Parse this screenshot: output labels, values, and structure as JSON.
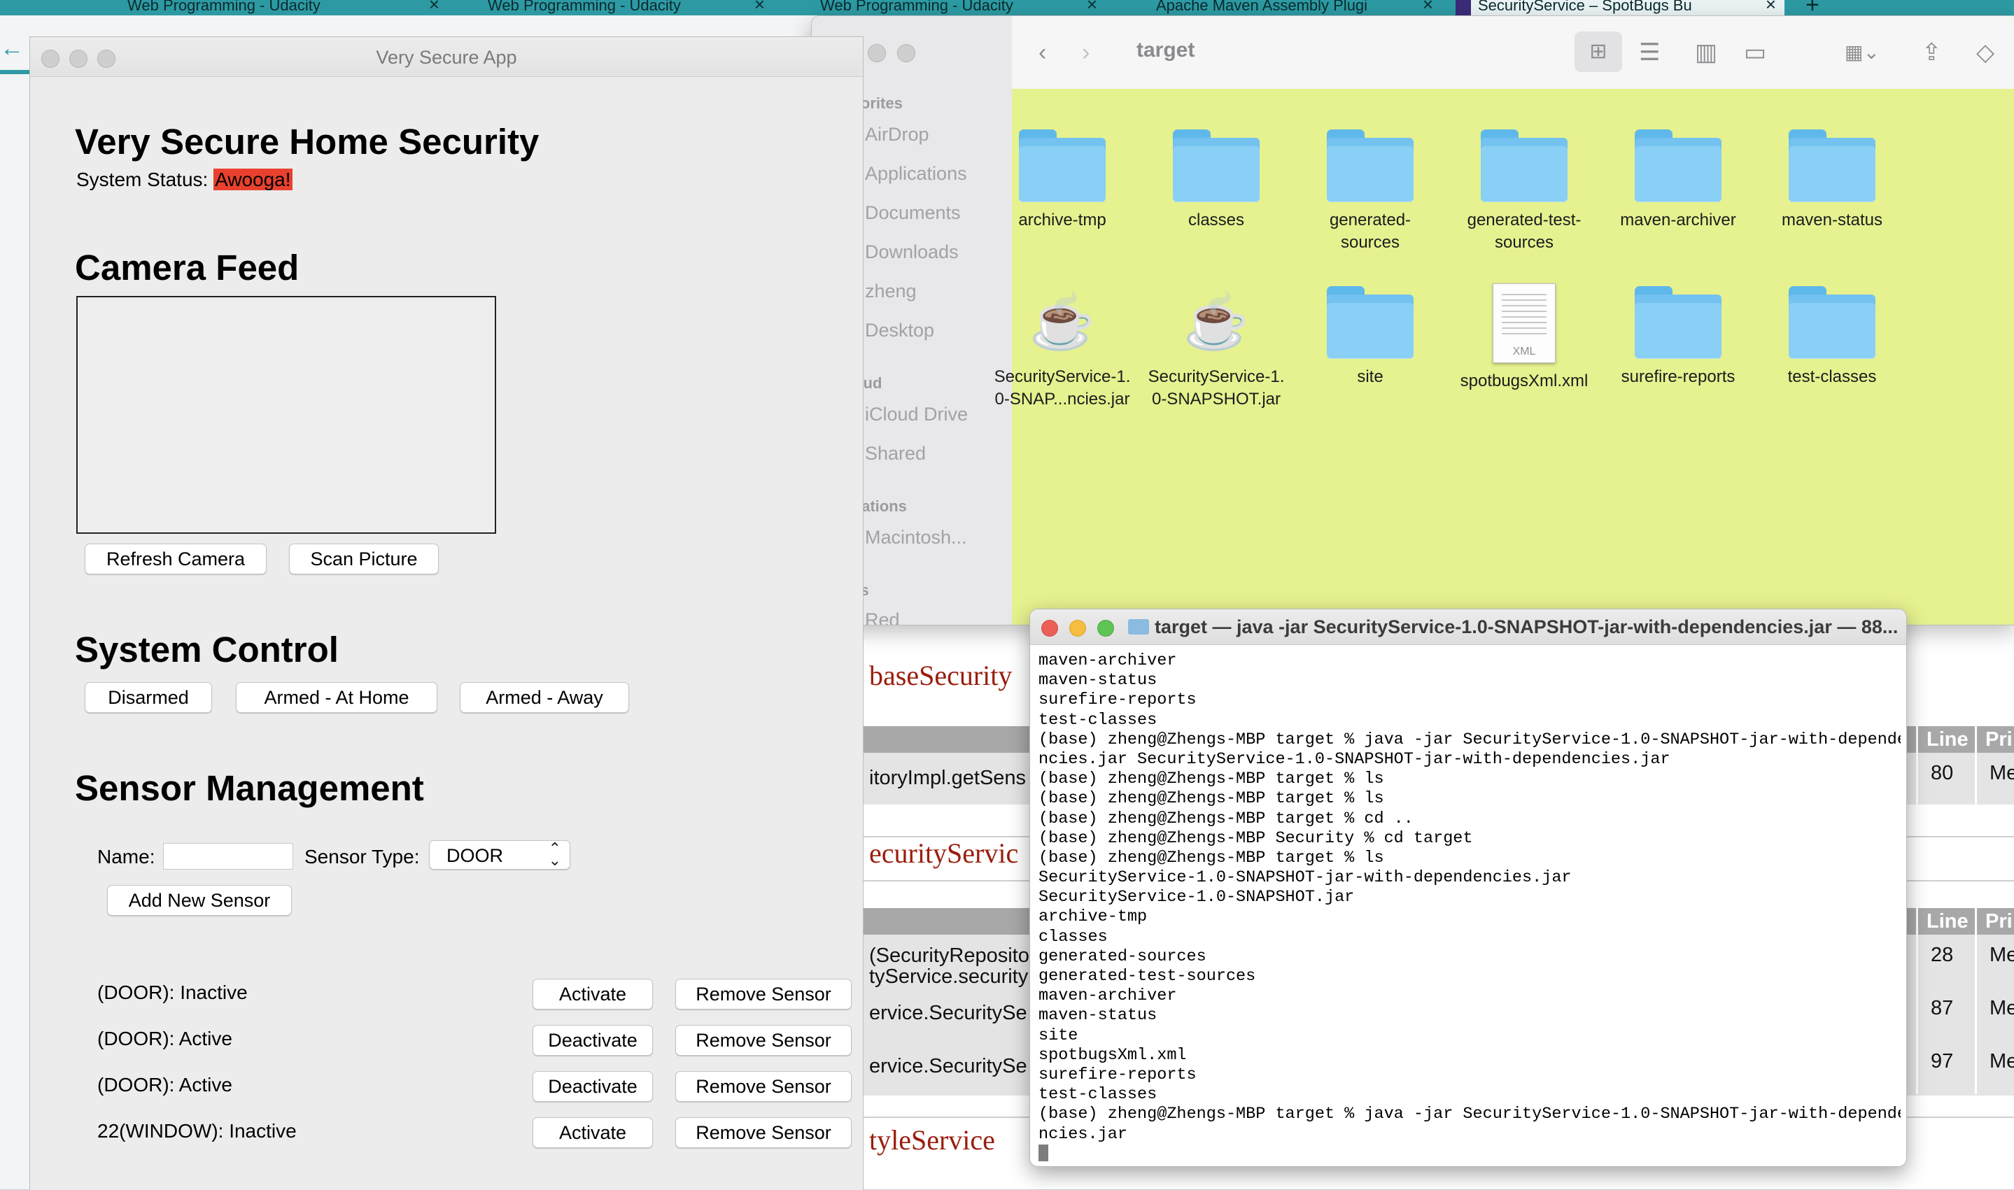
{
  "browser": {
    "tabs": [
      {
        "label": "Web Programming - Udacity",
        "active": false
      },
      {
        "label": "Web Programming - Udacity",
        "active": false
      },
      {
        "label": "Web Programming - Udacity",
        "active": false
      },
      {
        "label": "Apache Maven Assembly Plugi",
        "active": false
      },
      {
        "label": "SecurityService – SpotBugs Bu",
        "active": true
      }
    ],
    "new_tab": "+",
    "back": "←"
  },
  "report": {
    "section_1": "baseSecurity",
    "section_2": "ecurityServic",
    "section_3": "tyleService",
    "columns": {
      "line": "Line",
      "priority": "Pri"
    },
    "rows": [
      {
        "method": "itoryImpl.getSens",
        "line": "80",
        "priority": "Me"
      },
      {
        "method": "(SecurityReposito",
        "method2": "tyService.security",
        "line": "28",
        "priority": "Me"
      },
      {
        "method": "ervice.SecuritySe",
        "line": "87",
        "priority": "Me"
      },
      {
        "method": "ervice.SecuritySe",
        "line": "97",
        "priority": "Me"
      }
    ]
  },
  "app": {
    "window_title": "Very Secure App",
    "heading": "Very Secure Home Security",
    "status_label": "System Status:",
    "status_value": "Awooga!",
    "status_color": "#e9412e",
    "camera_heading": "Camera Feed",
    "refresh_camera": "Refresh Camera",
    "scan_picture": "Scan Picture",
    "system_control_heading": "System Control",
    "disarmed": "Disarmed",
    "armed_home": "Armed - At Home",
    "armed_away": "Armed - Away",
    "sensor_heading": "Sensor Management",
    "name_label": "Name:",
    "name_value": "",
    "sensor_type_label": "Sensor Type:",
    "sensor_type_value": "DOOR",
    "add_sensor": "Add New Sensor",
    "sensors": [
      {
        "label": "(DOOR): Inactive",
        "toggle": "Activate",
        "remove": "Remove Sensor"
      },
      {
        "label": "(DOOR): Active",
        "toggle": "Deactivate",
        "remove": "Remove Sensor"
      },
      {
        "label": "(DOOR): Active",
        "toggle": "Deactivate",
        "remove": "Remove Sensor"
      },
      {
        "label": "22(WINDOW): Inactive",
        "toggle": "Activate",
        "remove": "Remove Sensor"
      }
    ]
  },
  "finder": {
    "path": "target",
    "sidebar": {
      "favorites_heading": "Favorites",
      "favorites": [
        {
          "label": "AirDrop",
          "icon": "airdrop-icon"
        },
        {
          "label": "Applications",
          "icon": "applications-icon"
        },
        {
          "label": "Documents",
          "icon": "documents-icon"
        },
        {
          "label": "Downloads",
          "icon": "downloads-icon"
        },
        {
          "label": "zheng",
          "icon": "home-icon"
        },
        {
          "label": "Desktop",
          "icon": "desktop-icon"
        }
      ],
      "icloud_heading": "iCloud",
      "icloud": [
        {
          "label": "iCloud Drive",
          "icon": "cloud-icon"
        },
        {
          "label": "Shared",
          "icon": "shared-folder-icon"
        }
      ],
      "locations_heading": "Locations",
      "locations": [
        {
          "label": "Macintosh...",
          "icon": "disk-icon"
        }
      ],
      "tags_heading": "Tags",
      "tags": [
        {
          "label": "Red",
          "color": "#f4a4a4"
        }
      ]
    },
    "items": [
      {
        "name": "archive-tmp",
        "kind": "folder"
      },
      {
        "name": "classes",
        "kind": "folder"
      },
      {
        "name": "generated-\nsources",
        "kind": "folder"
      },
      {
        "name": "generated-test-\nsources",
        "kind": "folder"
      },
      {
        "name": "maven-archiver",
        "kind": "folder"
      },
      {
        "name": "maven-status",
        "kind": "folder"
      },
      {
        "name": "SecurityService-1.\n0-SNAP...ncies.jar",
        "kind": "jar"
      },
      {
        "name": "SecurityService-1.\n0-SNAPSHOT.jar",
        "kind": "jar"
      },
      {
        "name": "site",
        "kind": "folder"
      },
      {
        "name": "spotbugsXml.xml",
        "kind": "xml",
        "badge": "XML"
      },
      {
        "name": "surefire-reports",
        "kind": "folder"
      },
      {
        "name": "test-classes",
        "kind": "folder"
      }
    ],
    "content_color": "#e6f18f"
  },
  "terminal": {
    "title": "target — java -jar SecurityService-1.0-SNAPSHOT-jar-with-dependencies.jar — 88...",
    "lines": [
      "maven-archiver",
      "maven-status",
      "surefire-reports",
      "test-classes",
      "(base) zheng@Zhengs-MBP target % java -jar SecurityService-1.0-SNAPSHOT-jar-with-depende",
      "ncies.jar SecurityService-1.0-SNAPSHOT-jar-with-dependencies.jar",
      "(base) zheng@Zhengs-MBP target % ls",
      "(base) zheng@Zhengs-MBP target % ls",
      "(base) zheng@Zhengs-MBP target % cd ..",
      "(base) zheng@Zhengs-MBP Security % cd target",
      "(base) zheng@Zhengs-MBP target % ls",
      "SecurityService-1.0-SNAPSHOT-jar-with-dependencies.jar",
      "SecurityService-1.0-SNAPSHOT.jar",
      "archive-tmp",
      "classes",
      "generated-sources",
      "generated-test-sources",
      "maven-archiver",
      "maven-status",
      "site",
      "spotbugsXml.xml",
      "surefire-reports",
      "test-classes",
      "(base) zheng@Zhengs-MBP target % java -jar SecurityService-1.0-SNAPSHOT-jar-with-depende",
      "ncies.jar"
    ]
  }
}
